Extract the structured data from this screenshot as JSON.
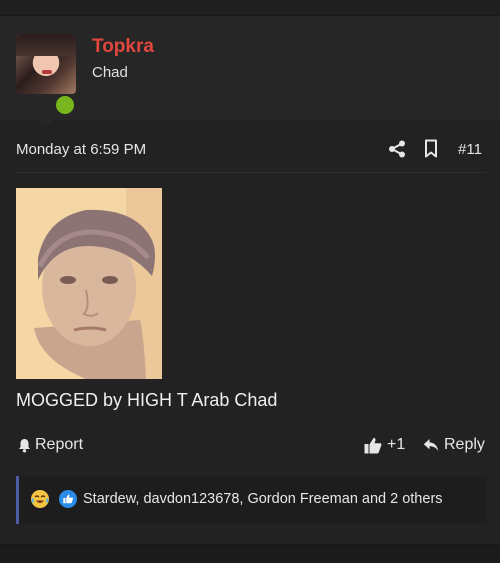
{
  "author": {
    "username": "Topkra",
    "title": "Chad",
    "online": true
  },
  "post": {
    "date": "Monday at 6:59 PM",
    "number": "#11",
    "text": "MOGGED by HIGH T Arab Chad"
  },
  "actions": {
    "report_label": "Report",
    "like_count": "+1",
    "reply_label": "Reply"
  },
  "reactions": {
    "users_text": "Stardew, davdon123678, Gordon Freeman and 2 others",
    "types": [
      "crying-laughing",
      "like"
    ]
  },
  "colors": {
    "username": "#e2463f",
    "online": "#79b51c",
    "reaction_border": "#4b5ea5",
    "background": "#222222"
  },
  "icons": [
    "share-icon",
    "bookmark-icon",
    "bell-icon",
    "thumbs-up-icon",
    "reply-icon"
  ]
}
